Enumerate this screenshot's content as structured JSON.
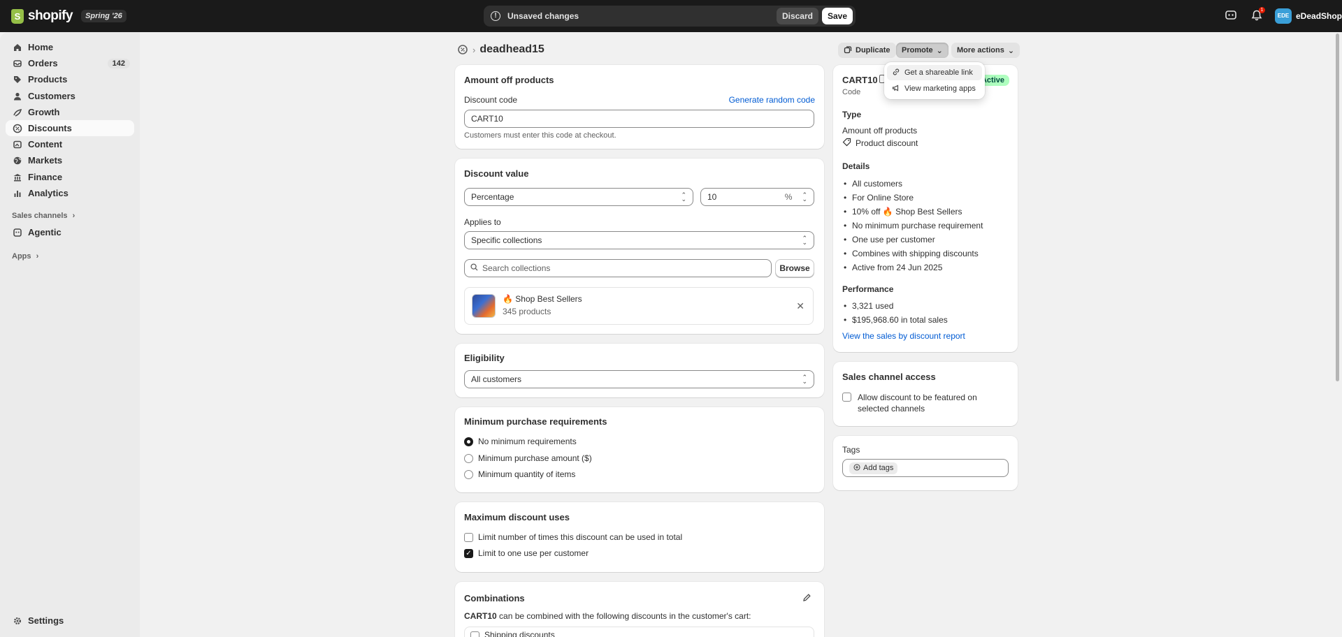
{
  "topbar": {
    "brand": "shopify",
    "edition": "Spring '26",
    "unsaved_message": "Unsaved changes",
    "discard_label": "Discard",
    "save_label": "Save",
    "notification_count": "1",
    "store_initials": "EDE",
    "store_name": "eDeadShop"
  },
  "sidebar": {
    "items": [
      {
        "label": "Home",
        "icon": "home-icon"
      },
      {
        "label": "Orders",
        "icon": "orders-icon",
        "count": "142"
      },
      {
        "label": "Products",
        "icon": "tag-icon"
      },
      {
        "label": "Customers",
        "icon": "person-icon"
      },
      {
        "label": "Growth",
        "icon": "growth-icon"
      },
      {
        "label": "Discounts",
        "icon": "discount-icon",
        "active": true
      },
      {
        "label": "Content",
        "icon": "content-icon"
      },
      {
        "label": "Markets",
        "icon": "globe-icon"
      },
      {
        "label": "Finance",
        "icon": "bank-icon"
      },
      {
        "label": "Analytics",
        "icon": "chart-icon"
      }
    ],
    "sales_channels_label": "Sales channels",
    "agentic_label": "Agentic",
    "apps_label": "Apps",
    "settings_label": "Settings"
  },
  "header": {
    "title": "deadhead15",
    "duplicate_label": "Duplicate",
    "promote_label": "Promote",
    "more_actions_label": "More actions"
  },
  "promote_menu": {
    "items": [
      "Get a shareable link",
      "View marketing apps"
    ]
  },
  "discount_code_card": {
    "title": "Amount off products",
    "code_label": "Discount code",
    "generate_label": "Generate random code",
    "code_value": "CART10",
    "help": "Customers must enter this code at checkout."
  },
  "discount_value_card": {
    "title": "Discount value",
    "type_value": "Percentage",
    "amount_value": "10",
    "amount_suffix": "%",
    "applies_to_label": "Applies to",
    "applies_to_value": "Specific collections",
    "search_placeholder": "Search collections",
    "browse_label": "Browse",
    "collection_name": "Shop Best Sellers",
    "collection_count": "345 products"
  },
  "eligibility_card": {
    "title": "Eligibility",
    "value": "All customers"
  },
  "min_purchase_card": {
    "title": "Minimum purchase requirements",
    "options": [
      "No minimum requirements",
      "Minimum purchase amount ($)",
      "Minimum quantity of items"
    ],
    "selected": 0
  },
  "max_uses_card": {
    "title": "Maximum discount uses",
    "options": [
      "Limit number of times this discount can be used in total",
      "Limit to one use per customer"
    ],
    "checked": [
      false,
      true
    ]
  },
  "combinations_card": {
    "title": "Combinations",
    "code": "CART10",
    "text": " can be combined with the following discounts in the customer's cart:",
    "first_option": "Shipping discounts"
  },
  "summary_card": {
    "code": "CART10",
    "status": "Active",
    "code_caption": "Code",
    "type_heading": "Type",
    "type_value": "Amount off products",
    "type_kind": "Product discount",
    "details_heading": "Details",
    "details": [
      "All customers",
      "For Online Store",
      "10% off",
      "Shop Best Sellers",
      "No minimum purchase requirement",
      "One use per customer",
      "Combines with shipping discounts",
      "Active from 24 Jun 2025"
    ],
    "performance_heading": "Performance",
    "performance": [
      "3,321 used",
      "$195,968.60 in total sales"
    ],
    "report_link": "View the sales by discount report"
  },
  "sales_channel_card": {
    "title": "Sales channel access",
    "checkbox_label_1": "Allow discount to be featured on",
    "checkbox_label_2": "selected channels"
  },
  "tags_card": {
    "title": "Tags",
    "add_label": "Add tags"
  },
  "colors": {
    "topbar": "#1a1a1a",
    "link": "#005bd3",
    "active_badge": "#affebf"
  }
}
